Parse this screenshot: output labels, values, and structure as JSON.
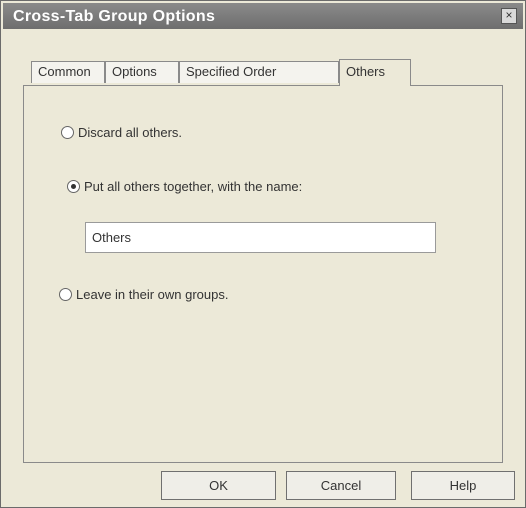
{
  "window": {
    "title": "Cross-Tab Group Options",
    "close_glyph": "×"
  },
  "tabs": [
    {
      "label": "Common",
      "active": false
    },
    {
      "label": "Options",
      "active": false
    },
    {
      "label": "Specified Order",
      "active": false
    },
    {
      "label": "Others",
      "active": true
    }
  ],
  "options": {
    "discard_label": "Discard all others.",
    "together_label": "Put all others together, with the name:",
    "together_name_value": "Others",
    "leave_label": "Leave in their own groups.",
    "selected": "together"
  },
  "buttons": {
    "ok": "OK",
    "cancel": "Cancel",
    "help": "Help"
  },
  "icons": {
    "close": "close-icon"
  }
}
